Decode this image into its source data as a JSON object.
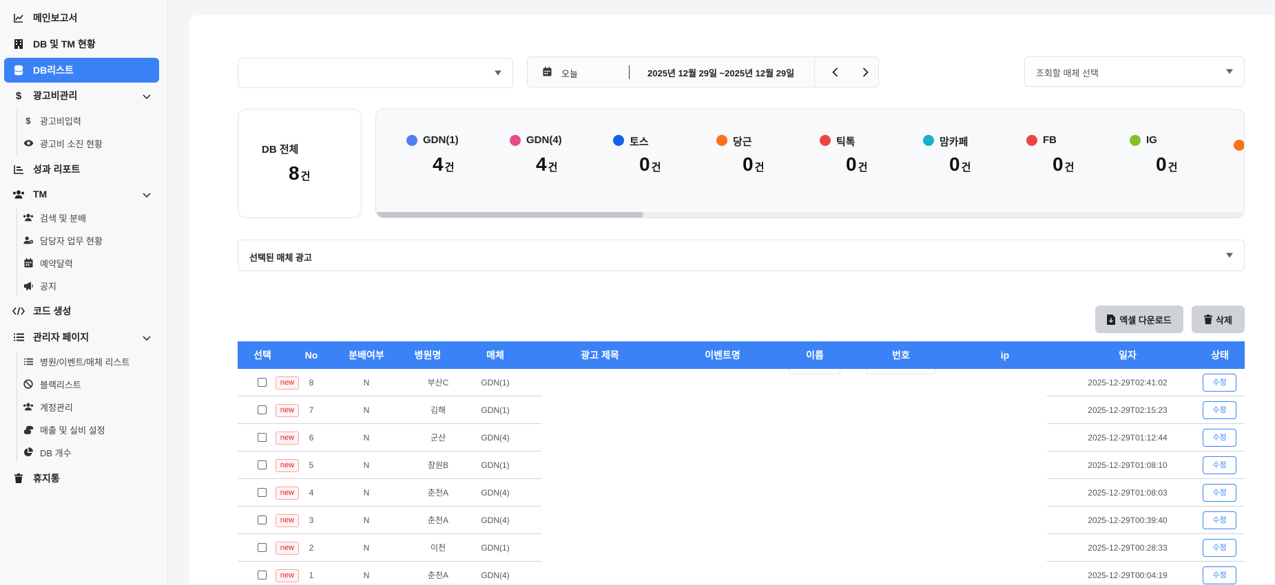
{
  "sidebar": {
    "main_report": "메인보고서",
    "db_tm_status": "DB 및 TM 현황",
    "db_list": "DB리스트",
    "ad_cost": "광고비관리",
    "ad_cost_input": "광고비입력",
    "ad_cost_spend": "광고비 소진 현황",
    "performance": "성과 리포트",
    "tm": "TM",
    "tm_search": "검색 및 분배",
    "tm_staff": "담당자 업무 현황",
    "tm_calendar": "예약달력",
    "tm_notice": "공지",
    "code_gen": "코드 생성",
    "admin": "관리자 페이지",
    "admin_list": "병원/이벤트/매체 리스트",
    "admin_blacklist": "블랙리스트",
    "admin_account": "계정관리",
    "admin_sales": "매출 및 실비 설정",
    "admin_dbcount": "DB 개수",
    "trash": "휴지통"
  },
  "filters": {
    "date_preset": "오늘",
    "date_range": "2025년 12월 29일 ~2025년 12월 29일",
    "media_select_placeholder": "조회할 매체 선택",
    "selected_media_ads": "선택된 매체 광고"
  },
  "summary": {
    "total_label": "DB 전체",
    "total_value": "8",
    "unit": "건"
  },
  "media_stats": [
    {
      "name": "GDN(1)",
      "value": "4",
      "color": "#4f7df3"
    },
    {
      "name": "GDN(4)",
      "value": "4",
      "color": "#e64c8c"
    },
    {
      "name": "토스",
      "value": "0",
      "color": "#1463e6"
    },
    {
      "name": "당근",
      "value": "0",
      "color": "#f97316"
    },
    {
      "name": "틱톡",
      "value": "0",
      "color": "#ef4444"
    },
    {
      "name": "맘카페",
      "value": "0",
      "color": "#16b0c8"
    },
    {
      "name": "FB",
      "value": "0",
      "color": "#ef4444"
    },
    {
      "name": "IG",
      "value": "0",
      "color": "#84c225"
    }
  ],
  "actions": {
    "excel": "엑셀 다운로드",
    "delete": "삭제"
  },
  "table": {
    "headers": [
      "선택",
      "No",
      "분배여부",
      "병원명",
      "매체",
      "광고 제목",
      "이벤트명",
      "이름",
      "번호",
      "ip",
      "일자",
      "상태"
    ],
    "new_label": "new",
    "edit_label": "수정",
    "rows": [
      {
        "no": "8",
        "dist": "N",
        "hospital": "부산C",
        "media": "GDN(1)",
        "date": "2025-12-29T02:41:02"
      },
      {
        "no": "7",
        "dist": "N",
        "hospital": "김해",
        "media": "GDN(1)",
        "date": "2025-12-29T02:15:23"
      },
      {
        "no": "6",
        "dist": "N",
        "hospital": "군산",
        "media": "GDN(4)",
        "date": "2025-12-29T01:12:44"
      },
      {
        "no": "5",
        "dist": "N",
        "hospital": "창원B",
        "media": "GDN(1)",
        "date": "2025-12-29T01:08:10"
      },
      {
        "no": "4",
        "dist": "N",
        "hospital": "춘천A",
        "media": "GDN(4)",
        "date": "2025-12-29T01:08:03"
      },
      {
        "no": "3",
        "dist": "N",
        "hospital": "춘천A",
        "media": "GDN(4)",
        "date": "2025-12-29T00:39:40"
      },
      {
        "no": "2",
        "dist": "N",
        "hospital": "이천",
        "media": "GDN(1)",
        "date": "2025-12-29T00:28:33"
      },
      {
        "no": "1",
        "dist": "N",
        "hospital": "춘천A",
        "media": "GDN(4)",
        "date": "2025-12-29T00:04:19"
      }
    ]
  },
  "colors": {
    "accent": "#3b82f6",
    "badge_red": "#e02424"
  }
}
